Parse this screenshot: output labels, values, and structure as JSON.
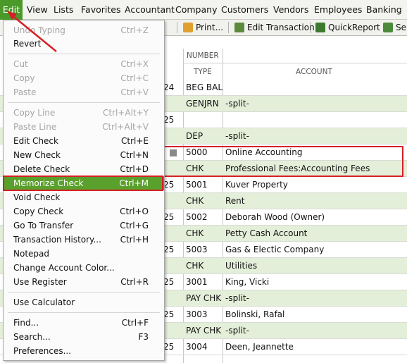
{
  "menubar": {
    "items": [
      "Edit",
      "View",
      "Lists",
      "Favorites",
      "Accountant",
      "Company",
      "Customers",
      "Vendors",
      "Employees",
      "Banking"
    ]
  },
  "toolbar": {
    "print_label": "Print...",
    "edit_transaction_label": "Edit Transaction",
    "quickreport_label": "QuickReport",
    "setup_label": "Se"
  },
  "register": {
    "header_number": "NUMBER",
    "header_type": "TYPE",
    "header_account": "ACCOUNT",
    "rows": [
      {
        "date": "24",
        "num": "BEG BAL",
        "acct": ""
      },
      {
        "date": "",
        "num": "GENJRN",
        "acct": "-split-"
      },
      {
        "date": "25",
        "num": "",
        "acct": ""
      },
      {
        "date": "",
        "num": "DEP",
        "acct": "-split-"
      },
      {
        "date": "",
        "num": "5000",
        "acct": "Online Accounting"
      },
      {
        "date": "",
        "num": "CHK",
        "acct": "Professional Fees:Accounting Fees"
      },
      {
        "date": "25",
        "num": "5001",
        "acct": "Kuver Property"
      },
      {
        "date": "",
        "num": "CHK",
        "acct": "Rent"
      },
      {
        "date": "25",
        "num": "5002",
        "acct": "Deborah Wood (Owner)"
      },
      {
        "date": "",
        "num": "CHK",
        "acct": "Petty Cash Account"
      },
      {
        "date": "25",
        "num": "5003",
        "acct": "Gas & Electic Company"
      },
      {
        "date": "",
        "num": "CHK",
        "acct": "Utilities"
      },
      {
        "date": "25",
        "num": "3001",
        "acct": "King, Vicki"
      },
      {
        "date": "",
        "num": "PAY CHK",
        "acct": "-split-"
      },
      {
        "date": "25",
        "num": "3003",
        "acct": "Bolinski, Rafal"
      },
      {
        "date": "",
        "num": "PAY CHK",
        "acct": "-split-"
      },
      {
        "date": "25",
        "num": "3004",
        "acct": "Deen, Jeannette"
      }
    ]
  },
  "edit_menu": {
    "items": [
      {
        "label": "Undo Typing",
        "shortcut": "Ctrl+Z",
        "disabled": true
      },
      {
        "label": "Revert",
        "shortcut": "",
        "disabled": false
      },
      {
        "label": "Cut",
        "shortcut": "Ctrl+X",
        "disabled": true
      },
      {
        "label": "Copy",
        "shortcut": "Ctrl+C",
        "disabled": true
      },
      {
        "label": "Paste",
        "shortcut": "Ctrl+V",
        "disabled": true
      },
      {
        "label": "Copy Line",
        "shortcut": "Ctrl+Alt+Y",
        "disabled": true
      },
      {
        "label": "Paste Line",
        "shortcut": "Ctrl+Alt+V",
        "disabled": true
      },
      {
        "label": "Edit Check",
        "shortcut": "Ctrl+E",
        "disabled": false
      },
      {
        "label": "New Check",
        "shortcut": "Ctrl+N",
        "disabled": false
      },
      {
        "label": "Delete Check",
        "shortcut": "Ctrl+D",
        "disabled": false
      },
      {
        "label": "Memorize Check",
        "shortcut": "Ctrl+M",
        "disabled": false,
        "highlighted": true
      },
      {
        "label": "Void Check",
        "shortcut": "",
        "disabled": false
      },
      {
        "label": "Copy Check",
        "shortcut": "Ctrl+O",
        "disabled": false
      },
      {
        "label": "Go To Transfer",
        "shortcut": "Ctrl+G",
        "disabled": false
      },
      {
        "label": "Transaction History...",
        "shortcut": "Ctrl+H",
        "disabled": false
      },
      {
        "label": "Notepad",
        "shortcut": "",
        "disabled": false
      },
      {
        "label": "Change Account Color...",
        "shortcut": "",
        "disabled": false
      },
      {
        "label": "Use Register",
        "shortcut": "Ctrl+R",
        "disabled": false
      },
      {
        "label": "Use Calculator",
        "shortcut": "",
        "disabled": false
      },
      {
        "label": "Find...",
        "shortcut": "Ctrl+F",
        "disabled": false
      },
      {
        "label": "Search...",
        "shortcut": "F3",
        "disabled": false
      },
      {
        "label": "Preferences...",
        "shortcut": "",
        "disabled": false
      }
    ]
  },
  "colors": {
    "menu_active": "#4a9a2a",
    "menu_highlight": "#5aa02c",
    "annotation_red": "#d62027",
    "row_alt": "#e4efda"
  }
}
